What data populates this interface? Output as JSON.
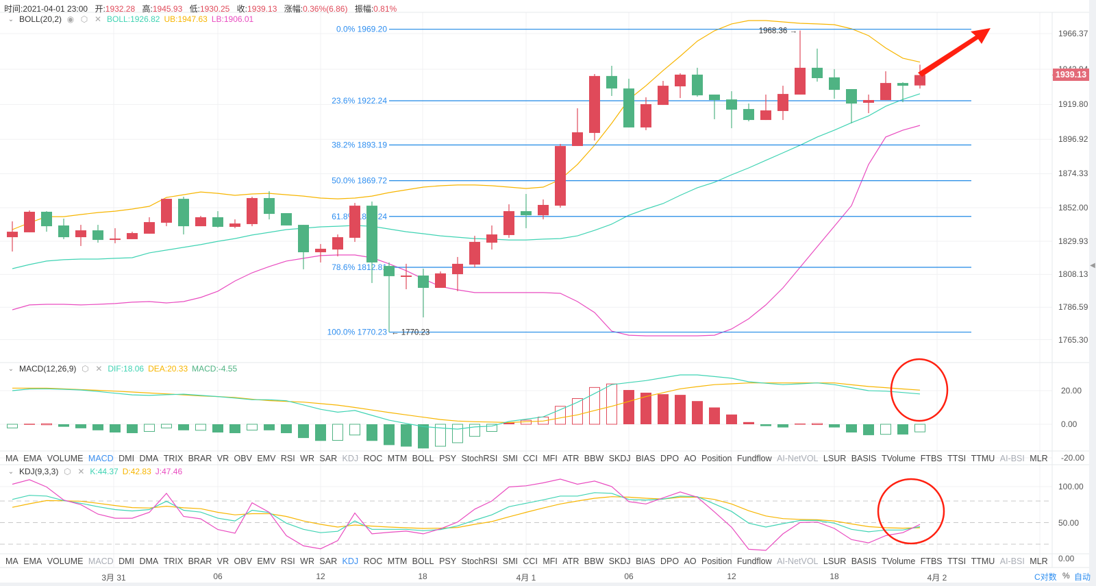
{
  "header": {
    "time_label": "时间:",
    "time": "2021-04-01 23:00",
    "open_label": "开:",
    "open": "1932.28",
    "high_label": "高:",
    "high": "1945.93",
    "low_label": "低:",
    "low": "1930.25",
    "close_label": "收:",
    "close": "1939.13",
    "change_label": "涨幅:",
    "change": "0.36%(6.86)",
    "amplitude_label": "振幅:",
    "amplitude": "0.81%"
  },
  "boll_legend": {
    "name": "BOLL(20,2)",
    "boll": "BOLL:1926.82",
    "ub": "UB:1947.63",
    "lb": "LB:1906.01",
    "icons": [
      "chevron-down-icon",
      "eye-icon",
      "gear-icon",
      "close-icon"
    ]
  },
  "macd_legend": {
    "name": "MACD(12,26,9)",
    "dif": "DIF:18.06",
    "dea": "DEA:20.33",
    "macd": "MACD:-4.55"
  },
  "kdj_legend": {
    "name": "KDJ(9,3,3)",
    "k": "K:44.37",
    "d": "D:42.83",
    "j": "J:47.46"
  },
  "indicator_tabs": {
    "labels": [
      "MA",
      "EMA",
      "VOLUME",
      "MACD",
      "DMI",
      "DMA",
      "TRIX",
      "BRAR",
      "VR",
      "OBV",
      "EMV",
      "RSI",
      "WR",
      "SAR",
      "KDJ",
      "ROC",
      "MTM",
      "BOLL",
      "PSY",
      "StochRSI",
      "SMI",
      "CCI",
      "MFI",
      "ATR",
      "BBW",
      "SKDJ",
      "BIAS",
      "DPO",
      "AO",
      "Position",
      "Fundflow",
      "AI-NetVOL",
      "LSUR",
      "BASIS",
      "TVolume",
      "FTBS",
      "TTSI",
      "TTMU",
      "AI-BSI",
      "MLR"
    ],
    "rows": [
      {
        "active": "MACD",
        "muted": [
          "KDJ",
          "AI-NetVOL",
          "AI-BSI"
        ]
      },
      {
        "active": "KDJ",
        "muted": [
          "MACD",
          "AI-NetVOL",
          "AI-BSI"
        ]
      }
    ]
  },
  "price_axis": [
    "1966.37",
    "1942.94",
    "1919.80",
    "1896.92",
    "1874.33",
    "1852.00",
    "1829.93",
    "1808.13",
    "1786.59",
    "1765.30"
  ],
  "macd_axis": [
    "20.00",
    "0.00",
    "-20.00"
  ],
  "kdj_axis": [
    "100.00",
    "50.00",
    "0.00"
  ],
  "time_axis": [
    "3月 31",
    "06",
    "12",
    "18",
    "4月 1",
    "06",
    "12",
    "18",
    "4月 2"
  ],
  "current_price": "1939.13",
  "scale_controls": {
    "log": "C对数",
    "percent": "%",
    "auto": "自动"
  },
  "colors": {
    "up": "#e04a5a",
    "down": "#4fb383",
    "boll_mid": "#3fd3b3",
    "boll_upper": "#f7b500",
    "boll_lower": "#e94cc0",
    "fib": "#1e88e5",
    "active_tab": "#3b8ff0",
    "annotation": "#ff2010"
  },
  "chart_data": [
    {
      "type": "candlestick",
      "interval": "1h",
      "ohlc_fields": [
        "open",
        "high",
        "low",
        "close"
      ],
      "candles": [
        [
          1832.6,
          1843.0,
          1823.2,
          1836.2
        ],
        [
          1835.8,
          1850.2,
          1835.8,
          1849.3
        ],
        [
          1849.3,
          1849.7,
          1836.2,
          1839.8
        ],
        [
          1840.3,
          1844.8,
          1831.3,
          1832.6
        ],
        [
          1832.6,
          1840.7,
          1826.8,
          1837.1
        ],
        [
          1837.1,
          1840.7,
          1829.0,
          1830.8
        ],
        [
          1830.8,
          1838.5,
          1828.6,
          1831.7
        ],
        [
          1831.3,
          1836.2,
          1831.3,
          1835.3
        ],
        [
          1834.9,
          1845.7,
          1834.9,
          1842.5
        ],
        [
          1842.1,
          1857.8,
          1839.8,
          1857.8
        ],
        [
          1857.8,
          1859.2,
          1834.4,
          1839.8
        ],
        [
          1839.8,
          1846.6,
          1839.8,
          1845.7
        ],
        [
          1845.7,
          1849.7,
          1838.9,
          1839.4
        ],
        [
          1839.4,
          1844.3,
          1838.5,
          1841.6
        ],
        [
          1841.2,
          1859.2,
          1839.8,
          1858.3
        ],
        [
          1858.3,
          1862.8,
          1844.3,
          1847.9
        ],
        [
          1848.4,
          1848.4,
          1840.3,
          1840.3
        ],
        [
          1840.7,
          1840.7,
          1811.5,
          1822.7
        ],
        [
          1822.7,
          1828.1,
          1816.0,
          1825.0
        ],
        [
          1824.5,
          1834.4,
          1820.0,
          1832.6
        ],
        [
          1832.2,
          1855.1,
          1829.5,
          1853.3
        ],
        [
          1853.3,
          1856.0,
          1802.5,
          1816.0
        ],
        [
          1813.7,
          1816.0,
          1770.23,
          1807.0
        ],
        [
          1806.5,
          1815.1,
          1798.4,
          1807.4
        ],
        [
          1807.4,
          1811.9,
          1779.9,
          1799.3
        ],
        [
          1799.3,
          1810.1,
          1799.3,
          1808.8
        ],
        [
          1808.3,
          1819.6,
          1797.1,
          1815.1
        ],
        [
          1814.6,
          1833.5,
          1812.8,
          1829.5
        ],
        [
          1829.0,
          1840.3,
          1824.5,
          1834.4
        ],
        [
          1834.0,
          1854.2,
          1832.2,
          1849.7
        ],
        [
          1849.7,
          1861.0,
          1838.5,
          1847.0
        ],
        [
          1847.0,
          1857.4,
          1844.3,
          1853.8
        ],
        [
          1853.3,
          1893.9,
          1852.0,
          1892.5
        ],
        [
          1892.5,
          1917.3,
          1892.5,
          1901.5
        ],
        [
          1901.1,
          1939.8,
          1896.1,
          1938.5
        ],
        [
          1938.5,
          1945.2,
          1925.4,
          1930.3
        ],
        [
          1930.3,
          1936.7,
          1904.7,
          1904.7
        ],
        [
          1904.7,
          1924.5,
          1902.9,
          1920.0
        ],
        [
          1919.5,
          1935.3,
          1919.5,
          1932.1
        ],
        [
          1931.7,
          1940.3,
          1924.0,
          1939.4
        ],
        [
          1939.4,
          1943.9,
          1924.9,
          1925.8
        ],
        [
          1926.3,
          1926.3,
          1910.1,
          1922.7
        ],
        [
          1923.1,
          1928.5,
          1904.2,
          1916.4
        ],
        [
          1916.8,
          1920.4,
          1908.7,
          1909.6
        ],
        [
          1909.6,
          1926.3,
          1909.6,
          1915.9
        ],
        [
          1915.5,
          1932.1,
          1909.6,
          1926.7
        ],
        [
          1926.3,
          1968.36,
          1926.3,
          1943.9
        ],
        [
          1943.9,
          1956.5,
          1934.8,
          1937.1
        ],
        [
          1937.6,
          1943.0,
          1923.6,
          1929.4
        ],
        [
          1929.9,
          1929.9,
          1907.4,
          1920.4
        ],
        [
          1920.9,
          1926.3,
          1914.1,
          1922.7
        ],
        [
          1922.7,
          1941.6,
          1922.7,
          1933.9
        ],
        [
          1933.9,
          1934.4,
          1921.3,
          1932.1
        ],
        [
          1932.28,
          1945.93,
          1930.25,
          1939.13
        ]
      ],
      "boll_upper": [
        1837.6,
        1842.1,
        1846.1,
        1846.1,
        1847.5,
        1848.8,
        1849.7,
        1851.1,
        1852.9,
        1858.7,
        1860.5,
        1862.3,
        1861.4,
        1860.1,
        1861.0,
        1861.4,
        1860.5,
        1859.6,
        1858.3,
        1857.8,
        1858.3,
        1859.6,
        1861.9,
        1863.7,
        1865.5,
        1866.4,
        1866.9,
        1866.9,
        1866.4,
        1865.5,
        1864.6,
        1865.5,
        1870.5,
        1880.4,
        1893.0,
        1907.4,
        1923.1,
        1932.1,
        1942.1,
        1951.5,
        1961.4,
        1968.2,
        1972.7,
        1974.9,
        1974.9,
        1974.0,
        1973.1,
        1972.7,
        1972.2,
        1969.5,
        1965.0,
        1956.9,
        1950.2,
        1947.63
      ],
      "boll_mid": [
        1811.9,
        1814.6,
        1816.9,
        1817.8,
        1818.2,
        1818.2,
        1818.7,
        1819.1,
        1822.3,
        1824.1,
        1825.9,
        1827.7,
        1829.9,
        1831.7,
        1834.0,
        1835.8,
        1837.6,
        1838.5,
        1839.4,
        1839.8,
        1840.3,
        1839.8,
        1838.0,
        1836.2,
        1834.9,
        1833.5,
        1832.6,
        1831.7,
        1831.3,
        1830.8,
        1830.8,
        1831.3,
        1831.7,
        1833.5,
        1837.1,
        1841.2,
        1847.0,
        1851.1,
        1854.7,
        1860.1,
        1865.1,
        1868.7,
        1873.6,
        1878.1,
        1883.1,
        1888.0,
        1893.0,
        1898.4,
        1902.9,
        1907.8,
        1912.3,
        1918.6,
        1923.1,
        1926.82
      ],
      "boll_lower": [
        1784.9,
        1788.1,
        1788.5,
        1788.5,
        1788.1,
        1788.5,
        1789.0,
        1789.9,
        1790.3,
        1789.4,
        1790.3,
        1793.0,
        1797.1,
        1803.8,
        1809.2,
        1813.3,
        1816.9,
        1818.7,
        1820.5,
        1820.9,
        1820.9,
        1819.1,
        1815.1,
        1810.6,
        1805.2,
        1800.2,
        1798.0,
        1796.2,
        1796.2,
        1796.2,
        1796.2,
        1796.2,
        1795.7,
        1790.3,
        1783.1,
        1770.9,
        1768.2,
        1767.8,
        1767.8,
        1767.8,
        1767.8,
        1768.2,
        1772.3,
        1779.0,
        1788.1,
        1799.3,
        1812.8,
        1826.3,
        1839.8,
        1853.3,
        1880.4,
        1898.4,
        1902.9,
        1906.01
      ],
      "fibonacci": [
        {
          "label": "0.0% 1969.20",
          "price": 1969.2
        },
        {
          "label": "23.6% 1922.24",
          "price": 1922.24
        },
        {
          "label": "38.2% 1893.19",
          "price": 1893.19
        },
        {
          "label": "50.0% 1869.72",
          "price": 1869.72
        },
        {
          "label": "61.8% 1846.24",
          "price": 1846.24
        },
        {
          "label": "78.6% 1812.81",
          "price": 1812.81
        },
        {
          "label": "100.0% 1770.23",
          "price": 1770.23
        }
      ],
      "annotations": {
        "high_label": "1968.36 →",
        "high": 1968.36,
        "low_label": "← 1770.23",
        "low": 1770.23
      },
      "ylim": [
        1765.3,
        1966.37
      ]
    },
    {
      "type": "macd",
      "histogram": [
        -2.2,
        0.3,
        0.3,
        -1.5,
        -2.4,
        -3.6,
        -4.9,
        -5.3,
        -4.3,
        -2.2,
        -3.6,
        -3.6,
        -4.9,
        -5.3,
        -3.5,
        -3.6,
        -5.3,
        -8.2,
        -9.9,
        -9.6,
        -6.4,
        -9.9,
        -12.4,
        -13.3,
        -14.4,
        -13.1,
        -11.0,
        -7.2,
        -4.3,
        1.0,
        2.4,
        4.3,
        10.7,
        15.3,
        21.9,
        24.0,
        20.4,
        18.8,
        17.9,
        17.5,
        13.8,
        10.0,
        5.8,
        1.3,
        -1.1,
        -1.9,
        0.4,
        0.4,
        -1.9,
        -4.9,
        -6.5,
        -6.0,
        -6.1,
        -4.55
      ],
      "dif": [
        20.0,
        21.0,
        21.1,
        20.8,
        20.4,
        19.5,
        18.5,
        17.5,
        17.2,
        17.6,
        17.9,
        17.2,
        16.5,
        15.6,
        14.6,
        14.6,
        14.0,
        11.5,
        8.9,
        7.2,
        8.2,
        5.3,
        2.4,
        0.5,
        -1.4,
        -2.2,
        -2.9,
        -1.6,
        -1.1,
        1.7,
        3.0,
        4.4,
        8.7,
        13.1,
        18.3,
        23.6,
        24.8,
        26.0,
        27.7,
        29.4,
        29.4,
        28.4,
        27.4,
        25.3,
        24.4,
        23.6,
        24.1,
        24.6,
        23.6,
        21.8,
        20.0,
        19.7,
        18.9,
        18.06
      ],
      "dea": [
        21.5,
        21.5,
        21.5,
        21.1,
        20.6,
        20.2,
        19.7,
        19.2,
        18.6,
        18.1,
        17.5,
        16.9,
        16.5,
        15.9,
        14.9,
        14.1,
        13.6,
        13.2,
        12.3,
        11.4,
        10.0,
        8.5,
        7.0,
        5.6,
        4.2,
        2.8,
        1.9,
        1.5,
        1.3,
        1.0,
        1.5,
        1.9,
        3.8,
        5.6,
        8.2,
        10.7,
        13.6,
        16.5,
        18.8,
        21.1,
        22.4,
        23.6,
        24.1,
        24.6,
        24.6,
        24.6,
        24.6,
        24.6,
        24.6,
        23.5,
        22.5,
        21.8,
        21.0,
        20.33
      ],
      "ylim": [
        -20,
        20
      ]
    },
    {
      "type": "kdj",
      "k": [
        82.2,
        87.9,
        86.9,
        80.6,
        76.9,
        72.1,
        68.1,
        66.2,
        68.1,
        79.7,
        67.1,
        64.6,
        56.1,
        52.3,
        67.1,
        64.0,
        49.2,
        40.7,
        36.0,
        37.9,
        52.3,
        40.7,
        40.7,
        40.7,
        38.8,
        40.4,
        45.4,
        53.3,
        60.8,
        72.1,
        76.9,
        81.6,
        86.9,
        86.9,
        91.6,
        90.7,
        82.2,
        81.3,
        82.8,
        86.9,
        86.0,
        75.9,
        65.5,
        49.2,
        43.8,
        48.6,
        53.0,
        53.0,
        49.2,
        40.7,
        37.2,
        39.7,
        39.7,
        44.37
      ],
      "d": [
        71.2,
        76.2,
        80.6,
        80.3,
        79.7,
        76.9,
        73.7,
        70.9,
        70.3,
        72.8,
        70.6,
        69.3,
        64.3,
        60.8,
        62.4,
        62.4,
        58.6,
        52.3,
        47.6,
        43.8,
        46.7,
        45.1,
        43.8,
        42.9,
        41.9,
        42.3,
        43.2,
        47.6,
        51.4,
        58.0,
        64.3,
        70.3,
        75.9,
        80.0,
        83.8,
        86.0,
        85.3,
        83.8,
        82.8,
        85.3,
        85.3,
        82.2,
        75.9,
        66.5,
        59.2,
        55.5,
        54.5,
        53.9,
        52.3,
        48.2,
        44.4,
        42.9,
        42.3,
        42.83
      ],
      "j": [
        103.3,
        109.6,
        99.5,
        81.3,
        75.0,
        61.8,
        56.1,
        56.1,
        64.3,
        90.7,
        58.6,
        55.2,
        40.4,
        35.3,
        77.5,
        64.3,
        31.9,
        17.7,
        13.6,
        25.0,
        63.3,
        34.4,
        36.6,
        38.2,
        34.4,
        41.3,
        50.8,
        68.7,
        80.0,
        99.5,
        101.1,
        105.2,
        110.5,
        103.3,
        107.7,
        100.1,
        79.1,
        75.9,
        84.4,
        92.6,
        85.3,
        64.9,
        43.5,
        13.0,
        11.4,
        34.4,
        50.1,
        50.8,
        41.9,
        26.5,
        21.8,
        31.9,
        36.0,
        47.46
      ],
      "reference_levels": [
        80,
        50,
        20
      ],
      "ylim": [
        0,
        100
      ]
    }
  ]
}
